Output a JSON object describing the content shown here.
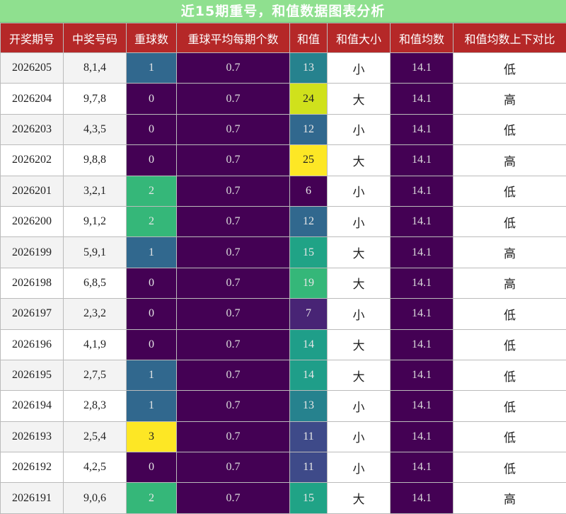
{
  "title": "近15期重号，和值数据图表分析",
  "chart_data": {
    "type": "table",
    "title": "近15期重号，和值数据图表分析",
    "columns": [
      "开奖期号",
      "中奖号码",
      "重球数",
      "重球平均每期个数",
      "和值",
      "和值大小",
      "和值均数",
      "和值均数上下对比"
    ],
    "rows": [
      {
        "period": "2026205",
        "numbers": "8,1,4",
        "repeat": 1,
        "avg_repeat": "0.7",
        "sum": 13,
        "size": "小",
        "sum_avg": "14.1",
        "compare": "低"
      },
      {
        "period": "2026204",
        "numbers": "9,7,8",
        "repeat": 0,
        "avg_repeat": "0.7",
        "sum": 24,
        "size": "大",
        "sum_avg": "14.1",
        "compare": "高"
      },
      {
        "period": "2026203",
        "numbers": "4,3,5",
        "repeat": 0,
        "avg_repeat": "0.7",
        "sum": 12,
        "size": "小",
        "sum_avg": "14.1",
        "compare": "低"
      },
      {
        "period": "2026202",
        "numbers": "9,8,8",
        "repeat": 0,
        "avg_repeat": "0.7",
        "sum": 25,
        "size": "大",
        "sum_avg": "14.1",
        "compare": "高"
      },
      {
        "period": "2026201",
        "numbers": "3,2,1",
        "repeat": 2,
        "avg_repeat": "0.7",
        "sum": 6,
        "size": "小",
        "sum_avg": "14.1",
        "compare": "低"
      },
      {
        "period": "2026200",
        "numbers": "9,1,2",
        "repeat": 2,
        "avg_repeat": "0.7",
        "sum": 12,
        "size": "小",
        "sum_avg": "14.1",
        "compare": "低"
      },
      {
        "period": "2026199",
        "numbers": "5,9,1",
        "repeat": 1,
        "avg_repeat": "0.7",
        "sum": 15,
        "size": "大",
        "sum_avg": "14.1",
        "compare": "高"
      },
      {
        "period": "2026198",
        "numbers": "6,8,5",
        "repeat": 0,
        "avg_repeat": "0.7",
        "sum": 19,
        "size": "大",
        "sum_avg": "14.1",
        "compare": "高"
      },
      {
        "period": "2026197",
        "numbers": "2,3,2",
        "repeat": 0,
        "avg_repeat": "0.7",
        "sum": 7,
        "size": "小",
        "sum_avg": "14.1",
        "compare": "低"
      },
      {
        "period": "2026196",
        "numbers": "4,1,9",
        "repeat": 0,
        "avg_repeat": "0.7",
        "sum": 14,
        "size": "大",
        "sum_avg": "14.1",
        "compare": "低"
      },
      {
        "period": "2026195",
        "numbers": "2,7,5",
        "repeat": 1,
        "avg_repeat": "0.7",
        "sum": 14,
        "size": "大",
        "sum_avg": "14.1",
        "compare": "低"
      },
      {
        "period": "2026194",
        "numbers": "2,8,3",
        "repeat": 1,
        "avg_repeat": "0.7",
        "sum": 13,
        "size": "小",
        "sum_avg": "14.1",
        "compare": "低"
      },
      {
        "period": "2026193",
        "numbers": "2,5,4",
        "repeat": 3,
        "avg_repeat": "0.7",
        "sum": 11,
        "size": "小",
        "sum_avg": "14.1",
        "compare": "低"
      },
      {
        "period": "2026192",
        "numbers": "4,2,5",
        "repeat": 0,
        "avg_repeat": "0.7",
        "sum": 11,
        "size": "小",
        "sum_avg": "14.1",
        "compare": "低"
      },
      {
        "period": "2026191",
        "numbers": "9,0,6",
        "repeat": 2,
        "avg_repeat": "0.7",
        "sum": 15,
        "size": "大",
        "sum_avg": "14.1",
        "compare": "高"
      }
    ],
    "colors": {
      "title_bg": "#8fe08f",
      "header_bg": "#b52828",
      "dark_cell": "#440154",
      "repeat_scale": {
        "0": "#440154",
        "1": "#31688e",
        "2": "#35b779",
        "3": "#fde725"
      },
      "sum_scale": {
        "6": "#440154",
        "7": "#482475",
        "11": "#3e4a89",
        "12": "#31688e",
        "13": "#26828e",
        "14": "#1f9e89",
        "15": "#20a386",
        "19": "#35b779",
        "24": "#d0e11c",
        "25": "#fde725"
      }
    }
  }
}
